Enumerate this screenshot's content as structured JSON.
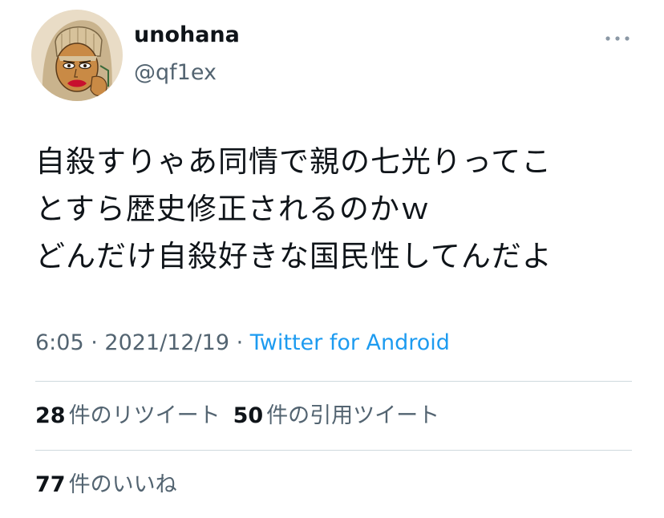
{
  "tweet": {
    "display_name": "unohana",
    "handle": "@qf1ex",
    "lines": [
      "自殺すりゃあ同情で親の七光りってこ",
      "とすら歴史修正されるのかｗ",
      "どんだけ自殺好きな国民性してんだよ"
    ],
    "time": "6:05",
    "date": "2021/12/19",
    "separator": " · ",
    "source": "Twitter for Android",
    "more_icon": "more-horizontal-icon"
  },
  "stats": {
    "retweets": {
      "count": "28",
      "label": "件のリツイート"
    },
    "quotes": {
      "count": "50",
      "label": "件の引用ツイート"
    },
    "likes": {
      "count": "77",
      "label": "件のいいね"
    }
  }
}
